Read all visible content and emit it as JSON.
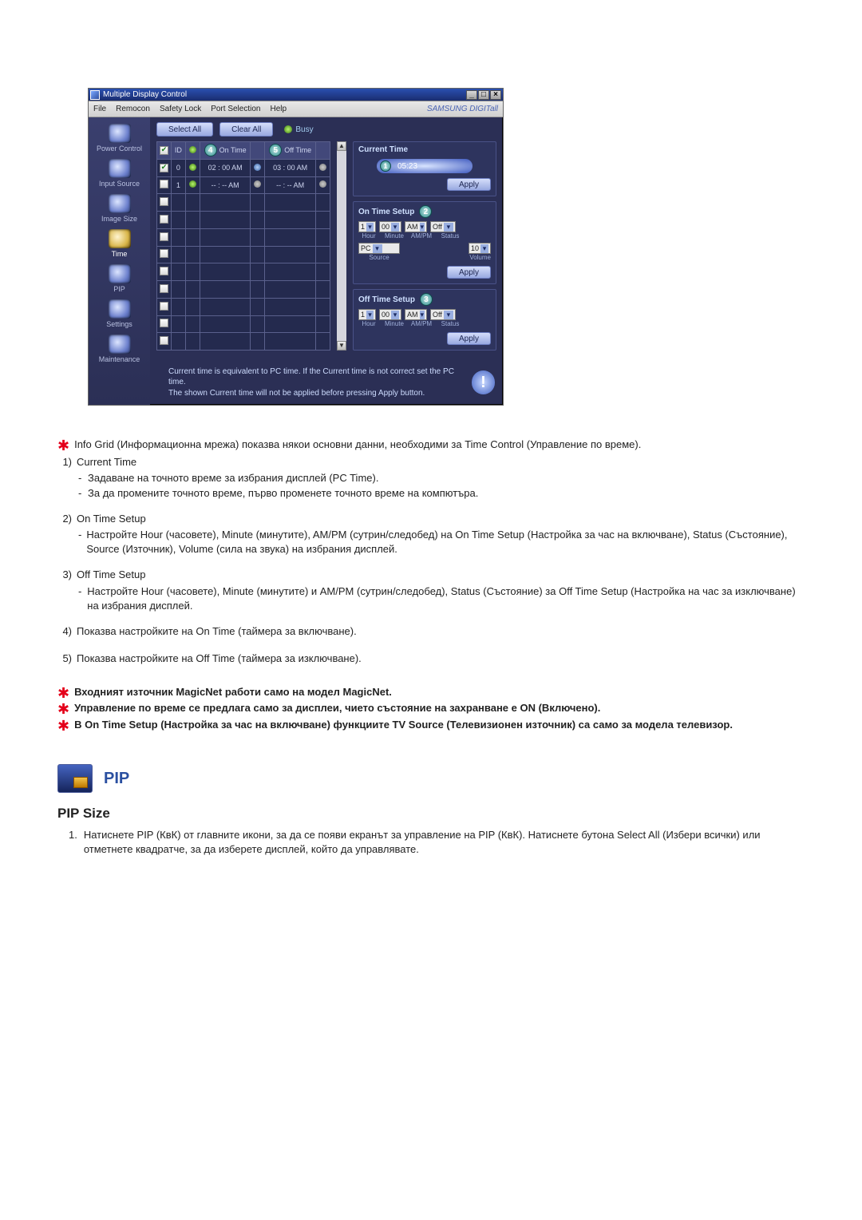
{
  "app": {
    "title": "Multiple Display Control",
    "menus": [
      "File",
      "Remocon",
      "Safety Lock",
      "Port Selection",
      "Help"
    ],
    "brand": "SAMSUNG DIGITall",
    "sidebar": [
      {
        "label": "Power Control"
      },
      {
        "label": "Input Source"
      },
      {
        "label": "Image Size"
      },
      {
        "label": "Time"
      },
      {
        "label": "PIP"
      },
      {
        "label": "Settings"
      },
      {
        "label": "Maintenance"
      }
    ],
    "buttons": {
      "select_all": "Select All",
      "clear_all": "Clear All",
      "apply": "Apply"
    },
    "busy_label": "Busy",
    "grid": {
      "badge4": "4",
      "badge5": "5",
      "hdr_on_time": "On Time",
      "hdr_off_time": "Off Time",
      "hdr_id": "ID",
      "rows": [
        {
          "chk": true,
          "id": "0",
          "led1": "green",
          "on": "02 : 00  AM",
          "led2": "blue",
          "off": "03 : 00  AM",
          "led3": "off"
        },
        {
          "chk": false,
          "id": "1",
          "led1": "green",
          "on": "-- : --  AM",
          "led2": "off",
          "off": "-- : --  AM",
          "led3": "off"
        },
        {
          "chk": false
        },
        {
          "chk": false
        },
        {
          "chk": false
        },
        {
          "chk": false
        },
        {
          "chk": false
        },
        {
          "chk": false
        },
        {
          "chk": false
        },
        {
          "chk": false
        },
        {
          "chk": false
        }
      ]
    },
    "panels": {
      "current_time": {
        "title": "Current Time",
        "badge": "1",
        "value": "05:23"
      },
      "on_time": {
        "title": "On Time Setup",
        "badge": "2",
        "hour": "1",
        "minute": "00",
        "ampm": "AM",
        "status": "Off",
        "source": "PC",
        "volume": "10",
        "labels": [
          "Hour",
          "Minute",
          "AM/PM",
          "Status"
        ],
        "labels2": [
          "Source",
          "Volume"
        ]
      },
      "off_time": {
        "title": "Off Time Setup",
        "badge": "3",
        "hour": "1",
        "minute": "00",
        "ampm": "AM",
        "status": "Off",
        "labels": [
          "Hour",
          "Minute",
          "AM/PM",
          "Status"
        ]
      }
    },
    "note1": "Current time is equivalent to PC time. If the Current time is not correct set the PC time.",
    "note2": "The shown Current time will not be applied before pressing Apply button."
  },
  "doc": {
    "intro": "Info Grid (Информационна мрежа) показва някои основни данни, необходими за Time Control (Управление по време).",
    "items": [
      {
        "n": "1)",
        "title": "Current Time",
        "subs": [
          "Задаване на точното време за избрания дисплей (PC Time).",
          "За да промените точното време, първо променете точното време на компютъра."
        ]
      },
      {
        "n": "2)",
        "title": "On Time Setup",
        "subs": [
          "Настройте Hour (часовете), Minute (минутите), AM/PM (сутрин/следобед) на On Time Setup (Настройка за час на включване), Status (Състояние), Source (Източник), Volume (сила на звука) на избрания дисплей."
        ]
      },
      {
        "n": "3)",
        "title": "Off Time Setup",
        "subs": [
          "Настройте Hour (часовете), Minute (минутите) и AM/PM (сутрин/следобед), Status (Състояние) за Off Time Setup (Настройка на час за изключване) на избрания дисплей."
        ]
      },
      {
        "n": "4)",
        "title": "Показва настройките на On Time (таймера за включване)."
      },
      {
        "n": "5)",
        "title": "Показва настройките на Off Time (таймера за изключване)."
      }
    ],
    "notes": [
      "Входният източник MagicNet работи само на модел MagicNet.",
      "Управление по време се предлага само за дисплеи, чието състояние на захранване е ON (Включено).",
      "В On Time Setup (Настройка за час на включване) функциите TV Source (Телевизионен източник) са само за модела телевизор."
    ],
    "pip": {
      "title": "PIP",
      "subtitle": "PIP Size",
      "ol_num": "1.",
      "ol_text": "Натиснете PIP (КвК) от главните икони, за да се появи екранът за управление на PIP (КвК). Натиснете бутона Select All (Избери всички) или отметнете квадратче, за да изберете дисплей, който да управлявате."
    }
  }
}
